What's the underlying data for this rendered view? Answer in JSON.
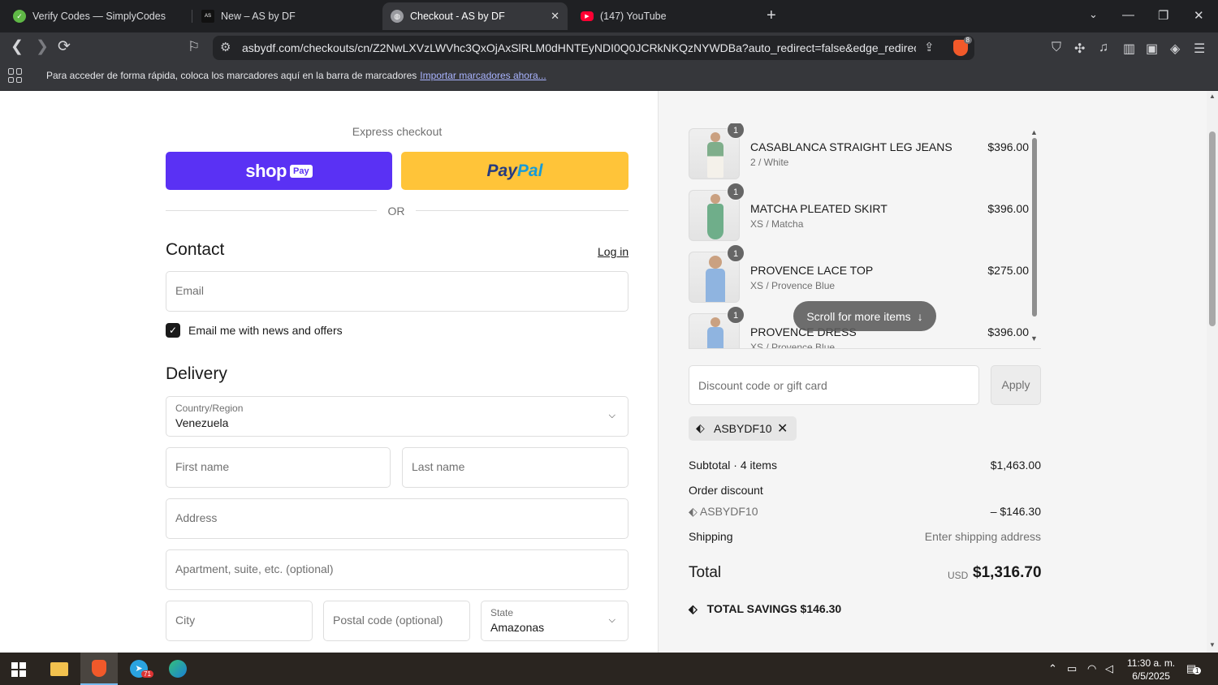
{
  "browser": {
    "tabs": [
      {
        "title": "Verify Codes — SimplyCodes",
        "icon": "simplycodes-icon",
        "active": false
      },
      {
        "title": "New – AS by DF",
        "icon": "asbydf-icon",
        "active": false
      },
      {
        "title": "Checkout - AS by DF",
        "icon": "globe-icon",
        "active": true
      },
      {
        "title": "(147) YouTube",
        "icon": "youtube-icon",
        "active": false
      }
    ],
    "url": "asbydf.com/checkouts/cn/Z2NwLXVzLWVhc3QxOjAxSlRLM0dHNTEyNDI0Q0JCRkNKQzNYWDBa?auto_redirect=false&edge_redirect=tr...",
    "shield_count": "8",
    "bookmarks_text": "Para acceder de forma rápida, coloca los marcadores aquí en la barra de marcadores",
    "bookmarks_link": "Importar marcadores ahora..."
  },
  "checkout": {
    "express_title": "Express checkout",
    "shop_pay_label": "shop",
    "shop_pay_badge": "Pay",
    "paypal_part1": "Pay",
    "paypal_part2": "Pal",
    "or_text": "OR",
    "contact_heading": "Contact",
    "login_link": "Log in",
    "email_placeholder": "Email",
    "news_checkbox_label": "Email me with news and offers",
    "news_checked": true,
    "delivery_heading": "Delivery",
    "country_label": "Country/Region",
    "country_value": "Venezuela",
    "first_name_placeholder": "First name",
    "last_name_placeholder": "Last name",
    "address_placeholder": "Address",
    "apartment_placeholder": "Apartment, suite, etc. (optional)",
    "city_placeholder": "City",
    "postal_placeholder": "Postal code (optional)",
    "state_label": "State",
    "state_value": "Amazonas"
  },
  "summary": {
    "items": [
      {
        "qty": "1",
        "name": "CASABLANCA STRAIGHT LEG JEANS",
        "variant": "2 / White",
        "price": "$396.00",
        "color": "#7fae8b"
      },
      {
        "qty": "1",
        "name": "MATCHA PLEATED SKIRT",
        "variant": "XS / Matcha",
        "price": "$396.00",
        "color": "#6fae8a"
      },
      {
        "qty": "1",
        "name": "PROVENCE LACE TOP",
        "variant": "XS / Provence Blue",
        "price": "$275.00",
        "color": "#8fb4e0"
      },
      {
        "qty": "1",
        "name": "PROVENCE DRESS",
        "variant": "XS / Provence Blue",
        "price": "$396.00",
        "color": "#8fb4e0"
      }
    ],
    "scroll_hint": "Scroll for more items",
    "discount_placeholder": "Discount code or gift card",
    "apply_label": "Apply",
    "applied_code": "ASBYDF10",
    "subtotal_label": "Subtotal · 4 items",
    "subtotal_value": "$1,463.00",
    "order_discount_label": "Order discount",
    "discount_code": "ASBYDF10",
    "discount_value": "– $146.30",
    "shipping_label": "Shipping",
    "shipping_value": "Enter shipping address",
    "total_label": "Total",
    "currency": "USD",
    "total_value": "$1,316.70",
    "savings_label": "TOTAL SAVINGS",
    "savings_value": "$146.30"
  },
  "taskbar": {
    "time": "11:30 a. m.",
    "date": "6/5/2025",
    "telegram_badge": "71",
    "notification_count": "1"
  }
}
